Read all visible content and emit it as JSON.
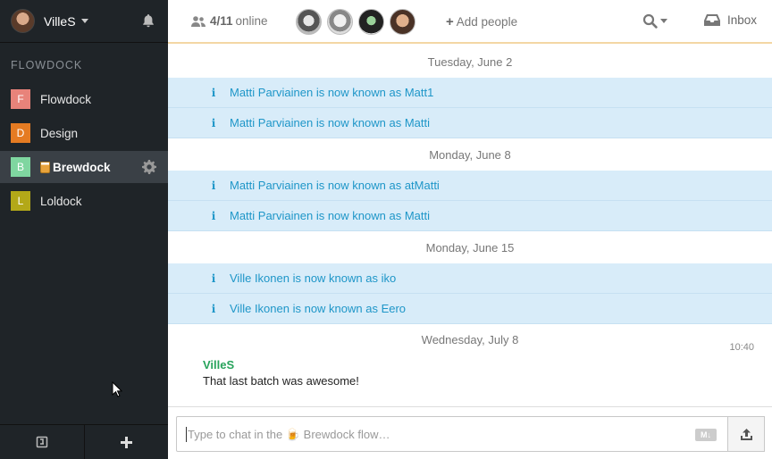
{
  "sidebar": {
    "user_name": "VilleS",
    "section_label": "FLOWDOCK",
    "flows": [
      {
        "letter": "F",
        "label": "Flowdock",
        "color": "#e8837a"
      },
      {
        "letter": "D",
        "label": "Design",
        "color": "#e57b22"
      },
      {
        "letter": "B",
        "label": "Brewdock",
        "color": "#7fd6a0"
      },
      {
        "letter": "L",
        "label": "Loldock",
        "color": "#b3a818"
      }
    ]
  },
  "topbar": {
    "online_count": "4/11",
    "online_label": "online",
    "add_people": "Add people",
    "inbox": "Inbox"
  },
  "messages": {
    "groups": [
      {
        "day": "Tuesday, June 2",
        "notices": [
          "Matti Parviainen is now known as Matt1",
          "Matti Parviainen is now known as Matti"
        ]
      },
      {
        "day": "Monday, June 8",
        "notices": [
          "Matti Parviainen is now known as atMatti",
          "Matti Parviainen is now known as Matti"
        ]
      },
      {
        "day": "Monday, June 15",
        "notices": [
          "Ville Ikonen is now known as iko",
          "Ville Ikonen is now known as Eero"
        ]
      }
    ],
    "last_day": "Wednesday, July 8",
    "chat": {
      "time": "10:40",
      "author": "VilleS",
      "text": "That last batch was awesome!"
    }
  },
  "composer": {
    "placeholder": "Type to chat in the 🍺 Brewdock flow…",
    "markdown_badge": "M↓"
  },
  "colors": {
    "sidebar_bg": "#1f2428",
    "notice_bg": "#d8ecf9",
    "notice_text": "#1e96c8",
    "author_green": "#27a35b"
  }
}
